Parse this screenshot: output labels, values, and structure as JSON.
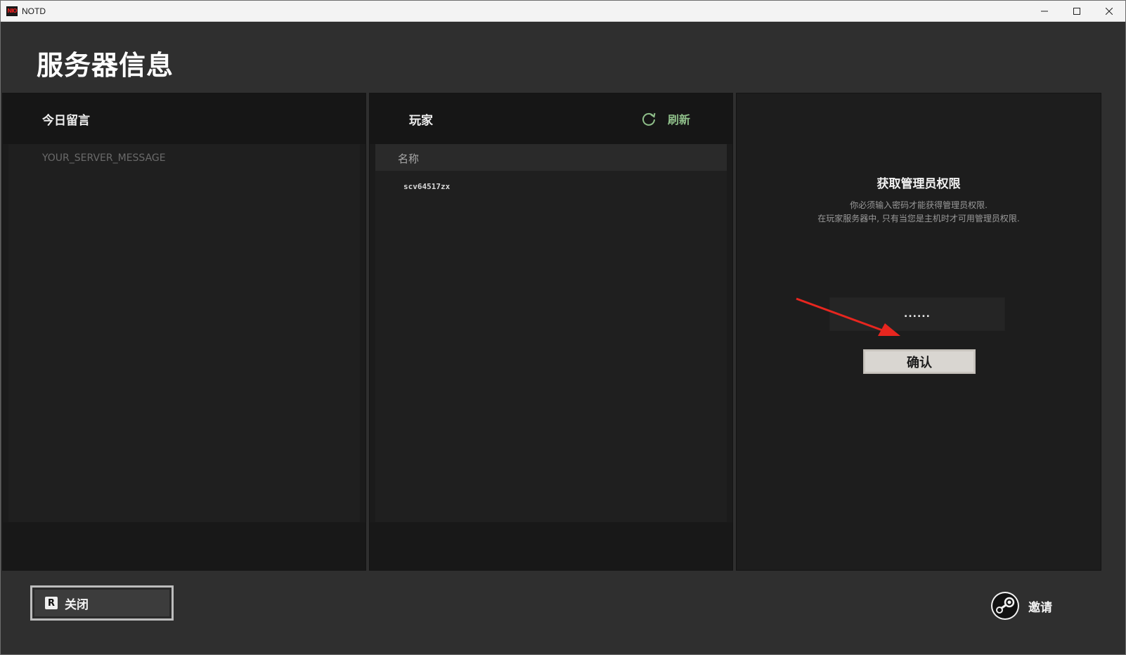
{
  "window": {
    "app_icon_text": "NIO",
    "title": "NOTD",
    "minimize": "minimize",
    "maximize": "maximize",
    "close": "close"
  },
  "page": {
    "title": "服务器信息"
  },
  "motd_panel": {
    "title": "今日留言",
    "message": "YOUR_SERVER_MESSAGE"
  },
  "players_panel": {
    "title": "玩家",
    "refresh_label": "刷新",
    "column_name": "名称",
    "players": [
      "scv64517zx"
    ]
  },
  "admin_panel": {
    "title": "获取管理员权限",
    "desc_line1": "你必须输入密码才能获得管理员权限.",
    "desc_line2": "在玩家服务器中, 只有当您是主机时才可用管理员权限.",
    "password_value": "......",
    "confirm_label": "确认"
  },
  "bottom_bar": {
    "close_key": "R",
    "close_label": "关闭",
    "invite_label": "邀请"
  },
  "colors": {
    "refresh_accent": "#8fbf8a",
    "annotation_arrow": "#e8261f"
  }
}
